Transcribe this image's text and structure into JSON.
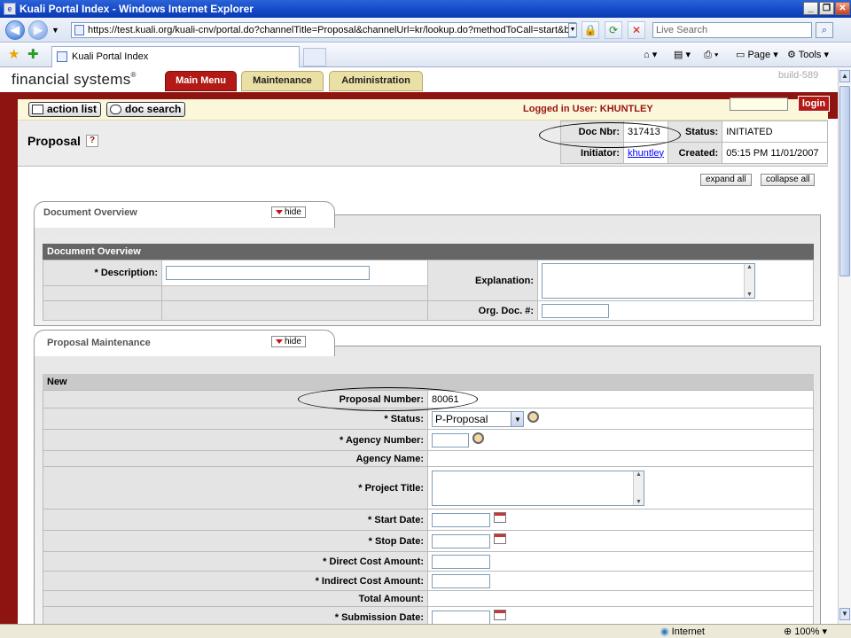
{
  "window": {
    "title": "Kuali Portal Index - Windows Internet Explorer"
  },
  "browser": {
    "url": "https://test.kuali.org/kuali-cnv/portal.do?channelTitle=Proposal&channelUrl=kr/lookup.do?methodToCall=start&businessO",
    "search_placeholder": "Live Search",
    "tab_title": "Kuali Portal Index",
    "page_label": "Page",
    "tools_label": "Tools",
    "status_zone": "Internet",
    "zoom": "100%"
  },
  "portal": {
    "logo_text": "financial systems",
    "tabs": [
      "Main Menu",
      "Maintenance",
      "Administration"
    ],
    "build": "build-589",
    "action_list_label": "action list",
    "doc_search_label": "doc search",
    "logged_in": "Logged in User: KHUNTLEY",
    "login_label": "login"
  },
  "doc_header": {
    "title": "Proposal",
    "help_glyph": "?",
    "doc_nbr_label": "Doc Nbr:",
    "doc_nbr": "317413",
    "status_label": "Status:",
    "status": "INITIATED",
    "initiator_label": "Initiator:",
    "initiator": "khuntley",
    "created_label": "Created:",
    "created": "05:15 PM 11/01/2007"
  },
  "controls": {
    "expand_all": "expand all",
    "collapse_all": "collapse all"
  },
  "doc_overview": {
    "tab_title": "Document Overview",
    "hide_label": "hide",
    "grid_header": "Document Overview",
    "description_label": "* Description:",
    "explanation_label": "Explanation:",
    "org_doc_label": "Org. Doc. #:"
  },
  "proposal_maintenance": {
    "tab_title": "Proposal Maintenance",
    "hide_label": "hide",
    "grid_header": "New",
    "proposal_number_label": "Proposal Number:",
    "proposal_number": "80061",
    "status_label": "* Status:",
    "status_value": "P-Proposal",
    "agency_number_label": "* Agency Number:",
    "agency_name_label": "Agency Name:",
    "project_title_label": "* Project Title:",
    "start_date_label": "* Start Date:",
    "stop_date_label": "* Stop Date:",
    "direct_cost_label": "* Direct Cost Amount:",
    "indirect_cost_label": "* Indirect Cost Amount:",
    "total_amount_label": "Total Amount:",
    "submission_date_label": "* Submission Date:"
  }
}
